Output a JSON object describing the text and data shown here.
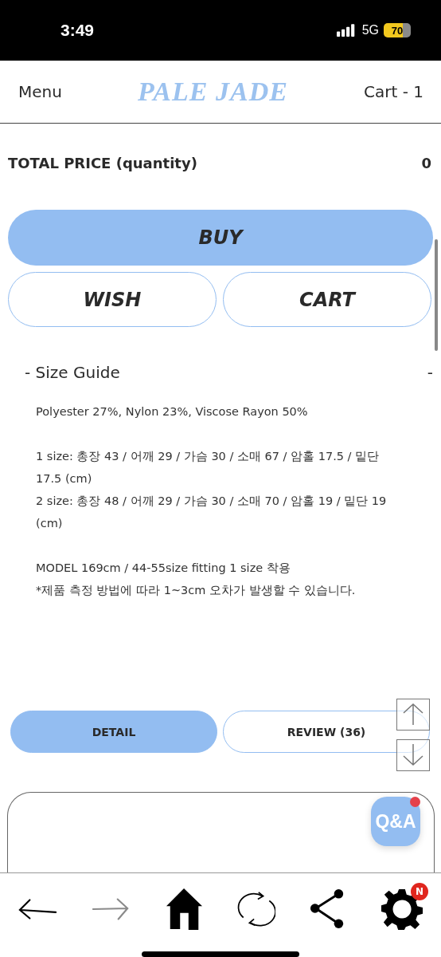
{
  "status_bar": {
    "time": "3:49",
    "network": "5G",
    "battery": "70"
  },
  "header": {
    "menu": "Menu",
    "logo": "PALE JADE",
    "cart": "Cart - 1"
  },
  "total": {
    "label": "TOTAL PRICE (quantity)",
    "value": "0"
  },
  "actions": {
    "primary": "BUY",
    "secondary": [
      "WISH",
      "CART"
    ]
  },
  "size_guide": {
    "title": "- Size Guide",
    "toggle": "-",
    "blocks": [
      [
        "Polyester 27%, Nylon 23%, Viscose Rayon 50%"
      ],
      [
        "1 size: 총장 43 / 어깨 29 / 가슴 30 / 소매 67 / 암홀 17.5 / 밑단 17.5 (cm)",
        "2 size: 총장 48 / 어깨 29 / 가슴 30 / 소매 70 / 암홀 19 / 밑단 19 (cm)"
      ],
      [
        "MODEL 169cm / 44-55size fitting 1 size  착용",
        "*제품 측정 방법에 따라 1~3cm 오차가 발생할 수 있습니다."
      ]
    ]
  },
  "tabs": [
    {
      "label": "DETAIL",
      "selected": true
    },
    {
      "label": "REVIEW (36)",
      "selected": false
    }
  ],
  "qa_button": {
    "label": "Q&A",
    "notification": true
  },
  "toolbar": [
    {
      "kind": "back",
      "disabled": false
    },
    {
      "kind": "forward",
      "disabled": true
    },
    {
      "kind": "home",
      "disabled": false
    },
    {
      "kind": "refresh",
      "disabled": false
    },
    {
      "kind": "share",
      "disabled": false
    },
    {
      "kind": "settings",
      "disabled": false,
      "badge": "N"
    }
  ]
}
